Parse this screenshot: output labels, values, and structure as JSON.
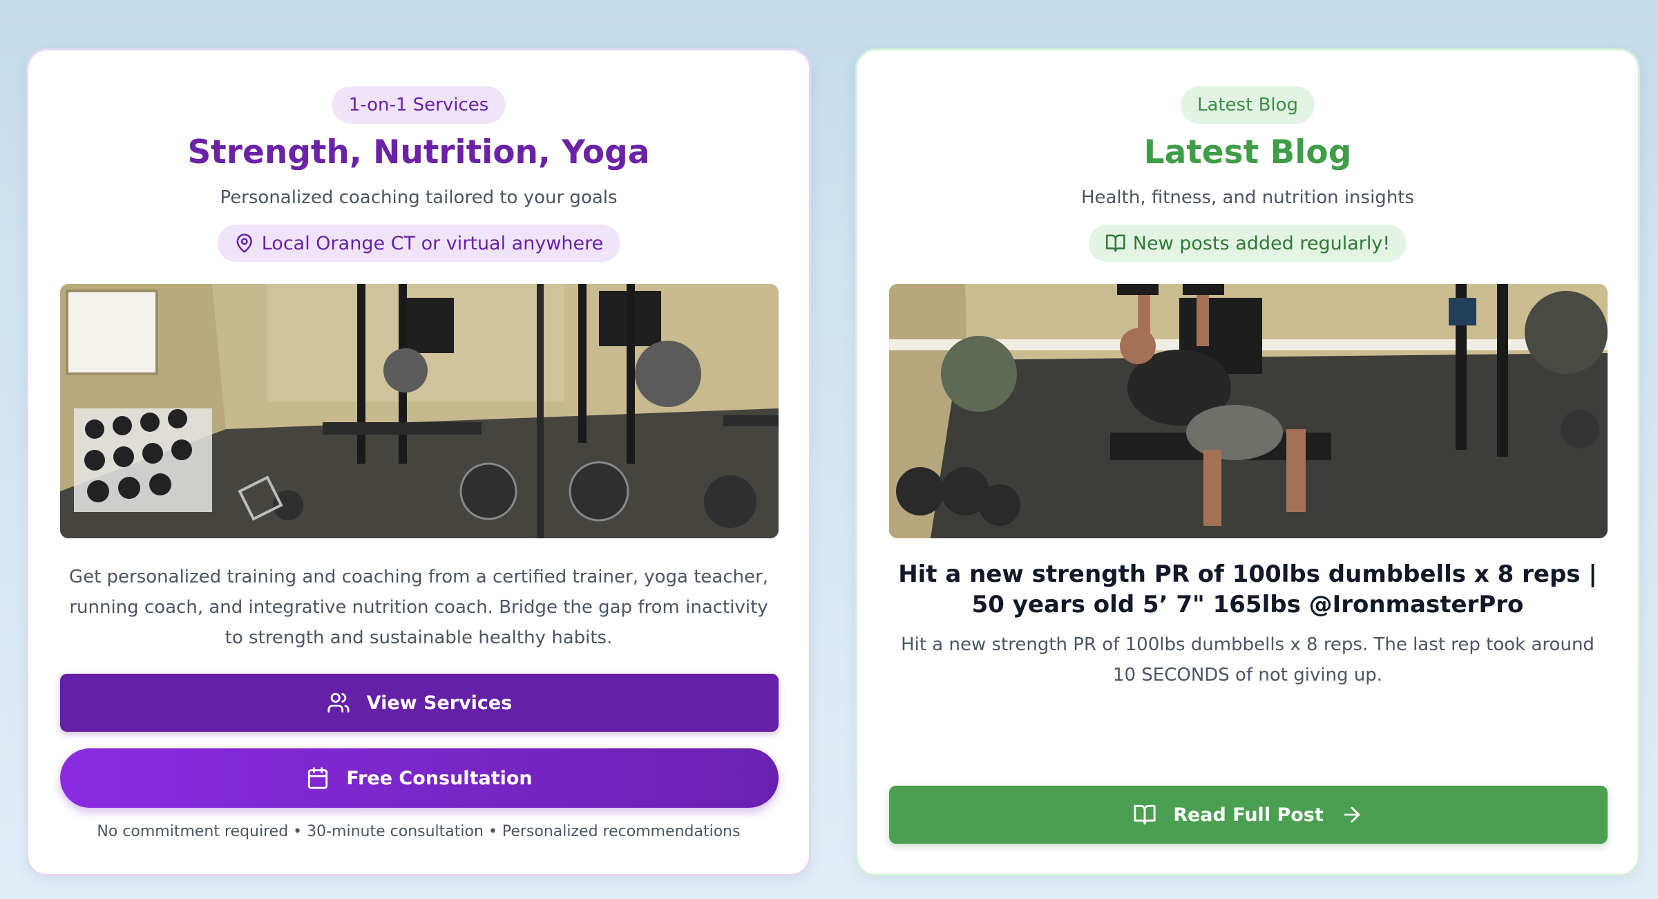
{
  "services_card": {
    "badge": "1-on-1 Services",
    "title": "Strength, Nutrition, Yoga",
    "subtitle": "Personalized coaching tailored to your goals",
    "location_icon": "map-pin-icon",
    "location": "Local Orange CT or virtual anywhere",
    "image_description": "home gym with dumbbell rack, power racks and barbell plates",
    "description": "Get personalized training and coaching from a certified trainer, yoga teacher, running coach, and integrative nutrition coach. Bridge the gap from inactivity to strength and sustainable healthy habits.",
    "view_services_label": "View Services",
    "view_services_icon": "users-icon",
    "consultation_label": "Free Consultation",
    "consultation_icon": "calendar-icon",
    "note": "No commitment required • 30-minute consultation • Personalized recommendations"
  },
  "blog_card": {
    "badge": "Latest Blog",
    "title": "Latest Blog",
    "subtitle": "Health, fitness, and nutrition insights",
    "tag_icon": "book-open-icon",
    "tag": "New posts added regularly!",
    "image_description": "man pressing dumbbells on a bench in a home gym",
    "post_title": "Hit a new strength PR of 100lbs dumbbells x 8 reps | 50 years old 5’ 7\" 165lbs @IronmasterPro",
    "post_excerpt": "Hit a new strength PR of 100lbs dumbbells x 8 reps. The last rep took around 10 SECONDS of not giving up.",
    "read_label": "Read Full Post",
    "read_icon": "book-open-icon",
    "read_arrow_icon": "arrow-right-icon"
  },
  "colors": {
    "purple": "#6b21a8",
    "purple_button": "#6520a8",
    "green": "#3f9d48",
    "green_button": "#4a9f50"
  }
}
